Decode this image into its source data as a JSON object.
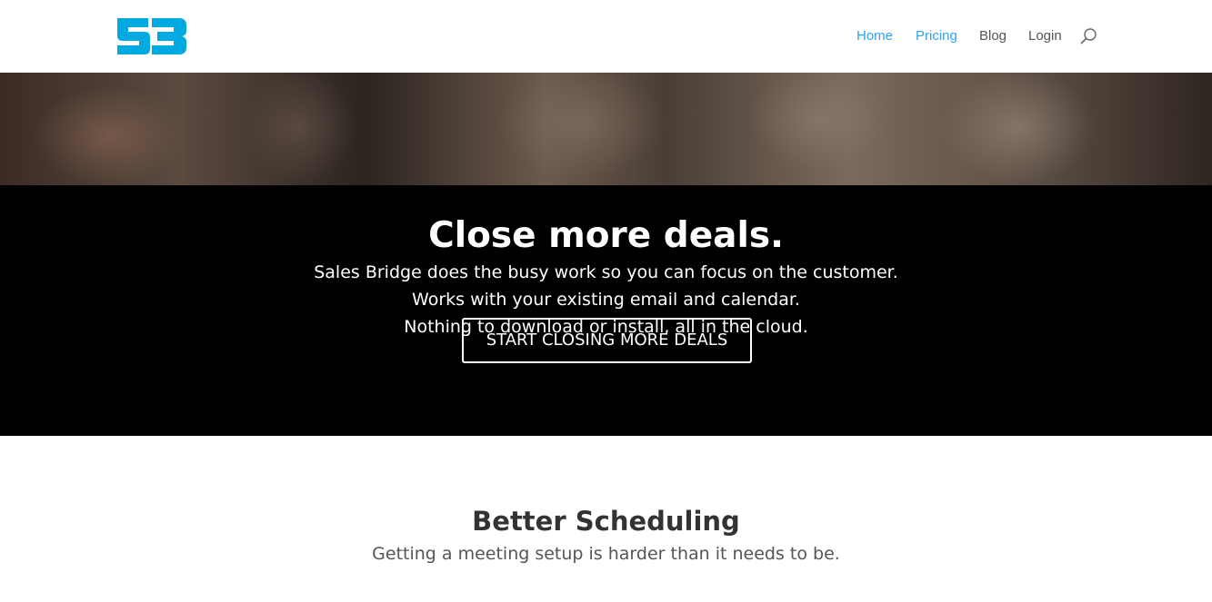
{
  "brand": {
    "logo_text": "SB",
    "accent_color": "#00a9e0"
  },
  "nav": {
    "items": [
      {
        "label": "Home",
        "active": true
      },
      {
        "label": "Pricing",
        "active": true
      },
      {
        "label": "Blog",
        "active": false
      },
      {
        "label": "Login",
        "active": false
      }
    ],
    "search_icon": "search-icon",
    "active_color": "#2ea3f2",
    "text_color": "#555555"
  },
  "hero": {
    "title": "Close more deals.",
    "lines": [
      "Sales Bridge does the busy work so you can focus on the customer.",
      "Works with your existing email and calendar.",
      "Nothing to download or install, all in the cloud."
    ],
    "cta_label": "START CLOSING MORE DEALS",
    "background_color": "#000000"
  },
  "features": {
    "title": "Better Scheduling",
    "subtitle": "Getting a meeting setup is harder than it needs to be."
  }
}
